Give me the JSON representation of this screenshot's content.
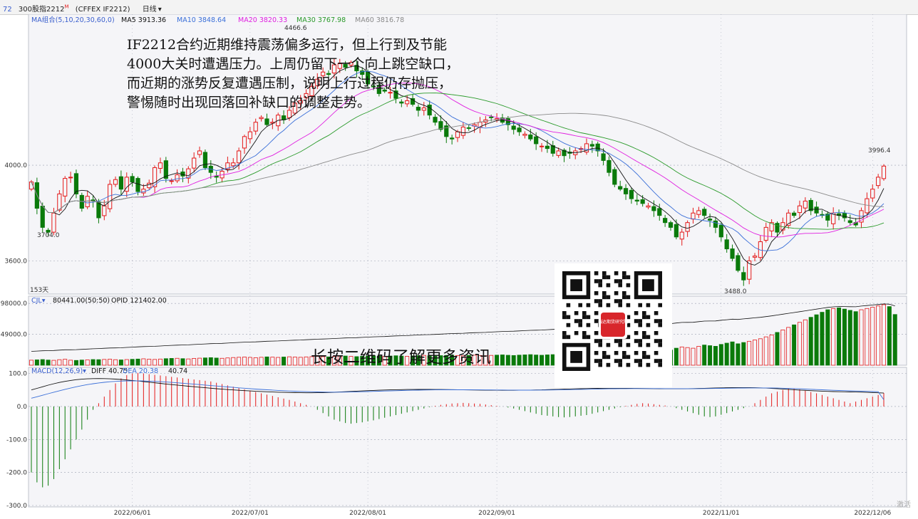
{
  "header": {
    "index_code": "72",
    "contract_name": "300股指2212",
    "contract_marker": "M",
    "exchange_code": "(CFFEX IF2212)",
    "period": "日线",
    "period_arrow": "▾"
  },
  "commentary": {
    "lines": [
      "IF2212合约近期维持震荡偏多运行，但上行到及节能",
      "4000大关时遭遇压力。上周仍留下一个向上跳空缺口，",
      "而近期的涨势反复遭遇压制，说明上行过程仍存抛压，",
      "警惕随时出现回落回补缺口的调整走势。"
    ]
  },
  "qr": {
    "badge_text": "瑞达期货研究院",
    "cta": "长按二维码了解更多资讯"
  },
  "watermark": "激活",
  "colors": {
    "up": "#e41a1a",
    "down": "#0a7a0a",
    "ma5": "#111111",
    "ma10": "#3a6fd8",
    "ma20": "#e020e0",
    "ma30": "#2a9a2a",
    "ma60": "#8a8a8a",
    "grid": "#9aa0b0",
    "panel_bg": "#f5f5f8"
  },
  "chart_data": [
    {
      "type": "candlestick",
      "name": "price",
      "legend": {
        "title": "MA组合(5,10,20,30,60,0)",
        "items": [
          {
            "label": "MA5",
            "value": "3913.36",
            "color": "#111111"
          },
          {
            "label": "MA10",
            "value": "3848.64",
            "color": "#3a6fd8"
          },
          {
            "label": "MA20",
            "value": "3820.33",
            "color": "#e020e0"
          },
          {
            "label": "MA30",
            "value": "3767.98",
            "color": "#2a9a2a"
          },
          {
            "label": "MA60",
            "value": "3816.78",
            "color": "#8a8a8a"
          }
        ]
      },
      "y_ticks": [
        "4000.0",
        "3600.0"
      ],
      "x_ticks": [
        "2022/06/01",
        "2022/07/01",
        "2022/08/01",
        "2022/09/01",
        "2022/11/01",
        "2022/12/06"
      ],
      "annotations": {
        "high": "4466.6",
        "low_1": "3704.0",
        "low_2": "3488.0",
        "last": "3996.4"
      },
      "bar_count_label": "153天",
      "ylim": [
        3470,
        4620
      ],
      "closes": [
        3930,
        3820,
        3740,
        3720,
        3800,
        3880,
        3945,
        3950,
        3880,
        3820,
        3870,
        3850,
        3780,
        3830,
        3920,
        3940,
        3900,
        3950,
        3930,
        3890,
        3900,
        3925,
        3990,
        4010,
        3945,
        3935,
        3960,
        3955,
        3985,
        4030,
        4060,
        3990,
        3970,
        3950,
        3975,
        4010,
        4010,
        4060,
        4120,
        4140,
        4180,
        4200,
        4170,
        4180,
        4210,
        4190,
        4230,
        4260,
        4270,
        4300,
        4330,
        4360,
        4390,
        4380,
        4420,
        4425,
        4410,
        4430,
        4395,
        4380,
        4340,
        4330,
        4300,
        4310,
        4305,
        4280,
        4260,
        4270,
        4255,
        4230,
        4240,
        4210,
        4180,
        4150,
        4120,
        4110,
        4140,
        4160,
        4155,
        4170,
        4180,
        4190,
        4200,
        4195,
        4180,
        4170,
        4150,
        4140,
        4130,
        4110,
        4090,
        4080,
        4070,
        4050,
        4060,
        4040,
        4050,
        4060,
        4070,
        4090,
        4080,
        4060,
        4020,
        3970,
        3920,
        3900,
        3880,
        3860,
        3850,
        3840,
        3830,
        3810,
        3790,
        3760,
        3740,
        3700,
        3720,
        3760,
        3800,
        3810,
        3790,
        3770,
        3740,
        3700,
        3650,
        3610,
        3560,
        3520,
        3600,
        3620,
        3680,
        3740,
        3760,
        3720,
        3760,
        3800,
        3790,
        3830,
        3850,
        3810,
        3800,
        3790,
        3770,
        3800,
        3790,
        3780,
        3760,
        3750,
        3810,
        3860,
        3900,
        3950,
        3996.4
      ],
      "ma_values": {
        "MA5": 3913.36,
        "MA10": 3848.64,
        "MA20": 3820.33,
        "MA30": 3767.98,
        "MA60": 3816.78
      }
    },
    {
      "type": "bar",
      "name": "volume",
      "legend": {
        "title": "CJL",
        "items": [
          {
            "label": "",
            "value": "80441.00(50:50)"
          },
          {
            "label": "OPID",
            "value": "121402.00"
          }
        ]
      },
      "y_ticks": [
        "98000.0",
        "49000.0"
      ],
      "ylim": [
        0,
        105000
      ],
      "values": [
        8000,
        8500,
        9000,
        8200,
        7800,
        8800,
        9500,
        8000,
        7600,
        8200,
        8600,
        9000,
        8800,
        9200,
        9600,
        8800,
        8400,
        9000,
        9400,
        9800,
        10200,
        9600,
        9200,
        9800,
        10400,
        10800,
        11000,
        10400,
        10000,
        10800,
        11200,
        11600,
        12000,
        11400,
        11000,
        11600,
        12200,
        12600,
        13000,
        12400,
        12000,
        12600,
        13200,
        12800,
        12400,
        13000,
        13400,
        13000,
        12600,
        13200,
        13600,
        14000,
        13600,
        13200,
        13800,
        14200,
        14600,
        14000,
        13600,
        14200,
        14600,
        15000,
        14400,
        14000,
        14600,
        15000,
        14600,
        14200,
        14800,
        15200,
        15600,
        15000,
        14600,
        15200,
        15600,
        16000,
        15400,
        15000,
        15600,
        16000,
        15400,
        15000,
        15600,
        16000,
        16400,
        15800,
        15400,
        16000,
        16400,
        16800,
        16200,
        15800,
        16400,
        16800,
        17200,
        16600,
        16200,
        16800,
        17200,
        17600,
        17000,
        16600,
        17200,
        17600,
        18000,
        17400,
        17000,
        17600,
        18000,
        20000,
        22000,
        24000,
        26000,
        25000,
        24000,
        27000,
        29000,
        28000,
        27000,
        30000,
        32000,
        31000,
        30000,
        33000,
        35000,
        37000,
        34000,
        36000,
        38000,
        40000,
        42000,
        45000,
        48000,
        52000,
        56000,
        60000,
        64000,
        68000,
        72000,
        76000,
        80000,
        84000,
        88000,
        90000,
        91000,
        89000,
        87000,
        85000,
        88000,
        90000,
        92000,
        94000,
        96000,
        93000,
        80441
      ]
    },
    {
      "type": "bar",
      "name": "MACD",
      "legend": {
        "title": "MACD(12,26,9)",
        "items": [
          {
            "label": "DIFF",
            "value": "40.75"
          },
          {
            "label": "DEA",
            "value": "20.38"
          },
          {
            "label": "",
            "value": "40.74"
          }
        ]
      },
      "y_ticks": [
        "100.0",
        "0.0",
        "-100.0",
        "-200.0",
        "-300.0"
      ],
      "ylim": [
        -300,
        110
      ],
      "values": [
        -200,
        -230,
        -245,
        -240,
        -220,
        -190,
        -160,
        -130,
        -100,
        -70,
        -40,
        -10,
        10,
        30,
        50,
        70,
        85,
        95,
        100,
        102,
        100,
        98,
        96,
        94,
        92,
        90,
        88,
        86,
        84,
        82,
        80,
        78,
        76,
        72,
        68,
        64,
        60,
        56,
        52,
        48,
        44,
        40,
        36,
        32,
        28,
        24,
        20,
        15,
        10,
        5,
        0,
        -10,
        -20,
        -30,
        -40,
        -45,
        -50,
        -52,
        -50,
        -48,
        -45,
        -42,
        -38,
        -34,
        -30,
        -26,
        -22,
        -18,
        -14,
        -10,
        -6,
        -2,
        2,
        5,
        7,
        9,
        10,
        11,
        10,
        9,
        8,
        6,
        4,
        2,
        0,
        -3,
        -6,
        -10,
        -14,
        -18,
        -22,
        -26,
        -28,
        -30,
        -32,
        -33,
        -32,
        -30,
        -28,
        -26,
        -22,
        -18,
        -14,
        -10,
        -6,
        -2,
        2,
        5,
        8,
        10,
        9,
        7,
        5,
        3,
        0,
        -5,
        -10,
        -15,
        -20,
        -25,
        -30,
        -32,
        -30,
        -25,
        -20,
        -15,
        -10,
        -5,
        0,
        10,
        20,
        30,
        40,
        45,
        50,
        55,
        55,
        52,
        48,
        44,
        40,
        35,
        30,
        25,
        20,
        15,
        10,
        15,
        20,
        25,
        30,
        35,
        40.74
      ],
      "diff_last": 40.75,
      "dea_last": 20.38
    }
  ]
}
